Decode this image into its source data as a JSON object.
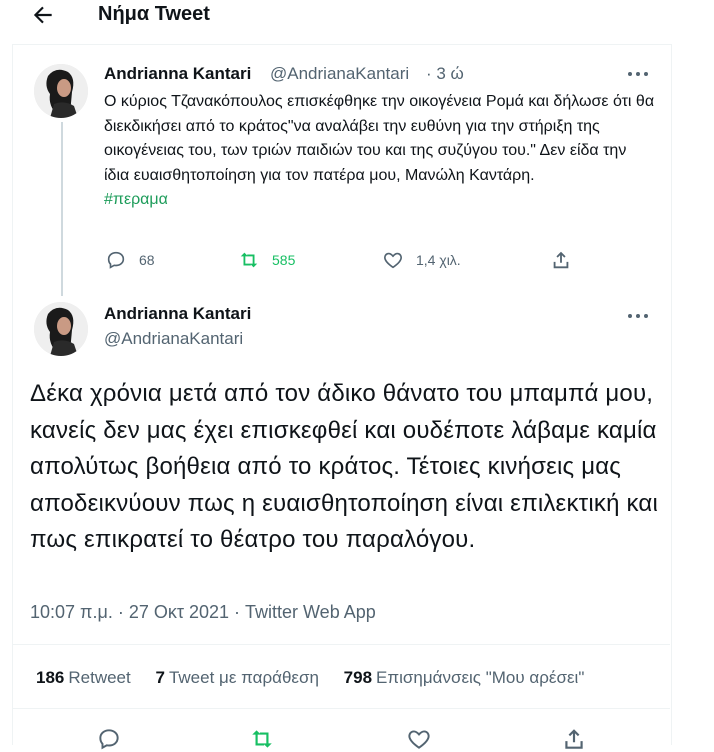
{
  "header": {
    "title": "Νήμα Tweet"
  },
  "quoted": {
    "name": "Andrianna Kantari",
    "handle": "@AndrianaKantari",
    "time": "· 3 ώ",
    "text": "Ο κύριος Τζανακόπουλος επισκέφθηκε την οικογένεια Ρομά και δήλωσε ότι θα διεκδικήσει από το κράτος\"να αναλάβει την ευθύνη για την στήριξη της οικογένειας του, των τριών παιδιών του και της συζύγου του.\" Δεν είδα την ίδια ευαισθητοποίηση για τον πατέρα μου, Μανώλη Καντάρη.",
    "hashtag": "#περαμα",
    "replies": "68",
    "retweets": "585",
    "likes": "1,4 χιλ."
  },
  "main": {
    "name": "Andrianna Kantari",
    "handle": "@AndrianaKantari",
    "text": "Δέκα χρόνια μετά από τον άδικο θάνατο του μπαμπά μου, κανείς δεν μας έχει επισκεφθεί και ουδέποτε λάβαμε καμία απολύτως βοήθεια από το κράτος. Τέτοιες κινήσεις μας αποδεικνύουν πως η ευαισθητοποίηση είναι επιλεκτική και πως επικρατεί το θέατρο του παραλόγου.",
    "meta": "10:07 π.μ. · 27 Οκτ 2021 · Twitter Web App"
  },
  "stats": {
    "retweets_count": "186",
    "retweets_label": "Retweet",
    "quotes_count": "7",
    "quotes_label": "Tweet με παράθεση",
    "likes_count": "798",
    "likes_label": "Επισημάνσεις \"Μου αρέσει\""
  },
  "colors": {
    "retweet_green": "#17bf63",
    "hashtag": "#1d9c5a",
    "secondary_text": "#536471"
  },
  "icons": [
    "back-arrow-icon",
    "more-icon",
    "reply-icon",
    "retweet-icon",
    "like-icon",
    "share-icon"
  ]
}
